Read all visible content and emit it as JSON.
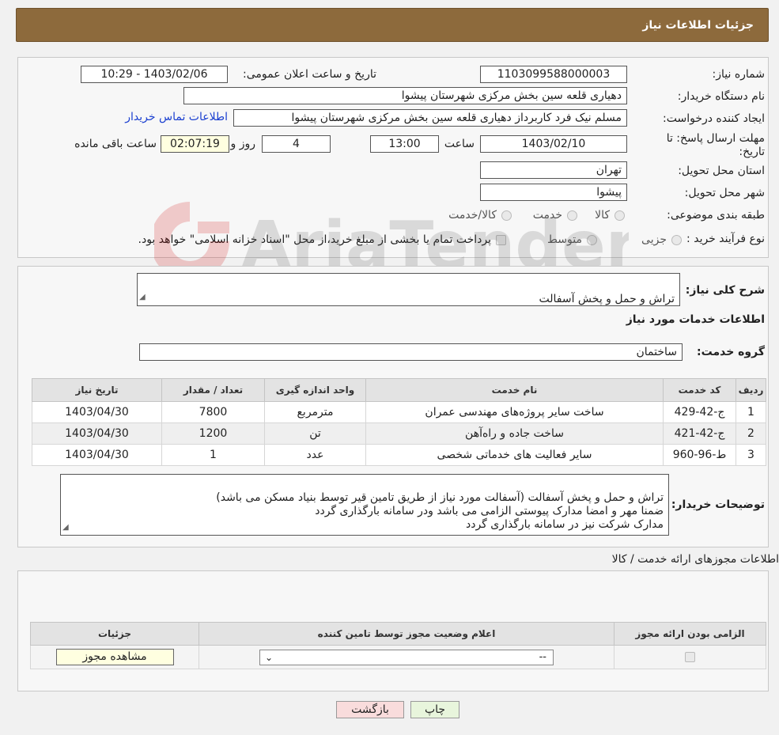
{
  "header": {
    "title": "جزئیات اطلاعات نیاز"
  },
  "need": {
    "number_label": "شماره نیاز:",
    "number": "1103099588000003",
    "announce_label": "تاریخ و ساعت اعلان عمومی:",
    "announce_value": "1403/02/06 - 10:29",
    "buyer_label": "نام دستگاه خریدار:",
    "buyer": "دهیاری قلعه سین بخش مرکزی شهرستان پیشوا",
    "creator_label": "ایجاد کننده درخواست:",
    "creator": "مسلم نیک فرد کاربرداز دهیاری قلعه سین بخش مرکزی شهرستان پیشوا",
    "contact_link": "اطلاعات تماس خریدار",
    "deadline_label": "مهلت ارسال پاسخ: تا",
    "deadline_label2": "تاریخ:",
    "deadline_date": "1403/02/10",
    "time_label": "ساعت",
    "deadline_time": "13:00",
    "days": "4",
    "days_label": "روز و",
    "remaining": "02:07:19",
    "remaining_label": "ساعت باقی مانده",
    "province_label": "استان محل تحویل:",
    "province": "تهران",
    "city_label": "شهر محل تحویل:",
    "city": "پیشوا",
    "category_label": "طبقه بندی موضوعی:",
    "category_options": [
      "کالا",
      "خدمت",
      "کالا/خدمت"
    ],
    "process_label": "نوع فرآیند خرید :",
    "process_options": [
      "جزیی",
      "متوسط"
    ],
    "payment_note": "پرداخت تمام یا بخشی از مبلغ خرید،از محل \"اسناد خزانه اسلامی\" خواهد بود."
  },
  "details": {
    "summary_label": "شرح کلی نیاز:",
    "summary": "تراش و حمل و پخش آسفالت",
    "services_title": "اطلاعات خدمات مورد نیاز",
    "group_label": "گروه خدمت:",
    "group": "ساختمان",
    "table": {
      "headers": [
        "ردیف",
        "کد خدمت",
        "نام خدمت",
        "واحد اندازه گیری",
        "تعداد / مقدار",
        "تاریخ نیاز"
      ],
      "rows": [
        [
          "1",
          "ج-42-429",
          "ساخت سایر پروژه‌های مهندسی عمران",
          "مترمربع",
          "7800",
          "1403/04/30"
        ],
        [
          "2",
          "ج-42-421",
          "ساخت جاده و راه‌آهن",
          "تن",
          "1200",
          "1403/04/30"
        ],
        [
          "3",
          "ط-96-960",
          "سایر فعالیت های خدماتی شخصی",
          "عدد",
          "1",
          "1403/04/30"
        ]
      ]
    },
    "buyer_notes_label": "توضیحات خریدار:",
    "buyer_notes": "تراش و حمل و پخش آسفالت (آسفالت مورد نیاز از طریق تامین قیر توسط بنیاد مسکن می باشد)\nضمنا مهر و امضا مدارک پیوستی الزامی می باشد ودر سامانه بارگذاری گردد\nمدارک شرکت نیز در سامانه بارگذاری گردد"
  },
  "permits": {
    "title": "اطلاعات مجوزهای ارائه خدمت / کالا",
    "headers": [
      "الزامی بودن ارائه مجوز",
      "اعلام وضعیت مجوز توسط تامین کننده",
      "جزئیات"
    ],
    "select_value": "--",
    "view_button": "مشاهده مجوز"
  },
  "actions": {
    "print": "چاپ",
    "back": "بازگشت"
  },
  "watermark": "AriaTender.neT"
}
